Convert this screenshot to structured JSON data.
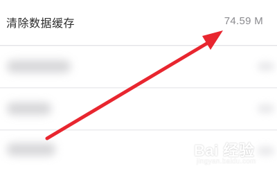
{
  "settings": {
    "clear_cache_row": {
      "label": "清除数据缓存",
      "value": "74.59 M"
    }
  },
  "colors": {
    "arrow": "#e8262f",
    "row_background": "#ffffff",
    "page_background": "#f4f4f6",
    "value_text": "#8a8a8e"
  },
  "watermark": {
    "brand": "Bai 经验",
    "url": "jingyan.baidu.com"
  }
}
